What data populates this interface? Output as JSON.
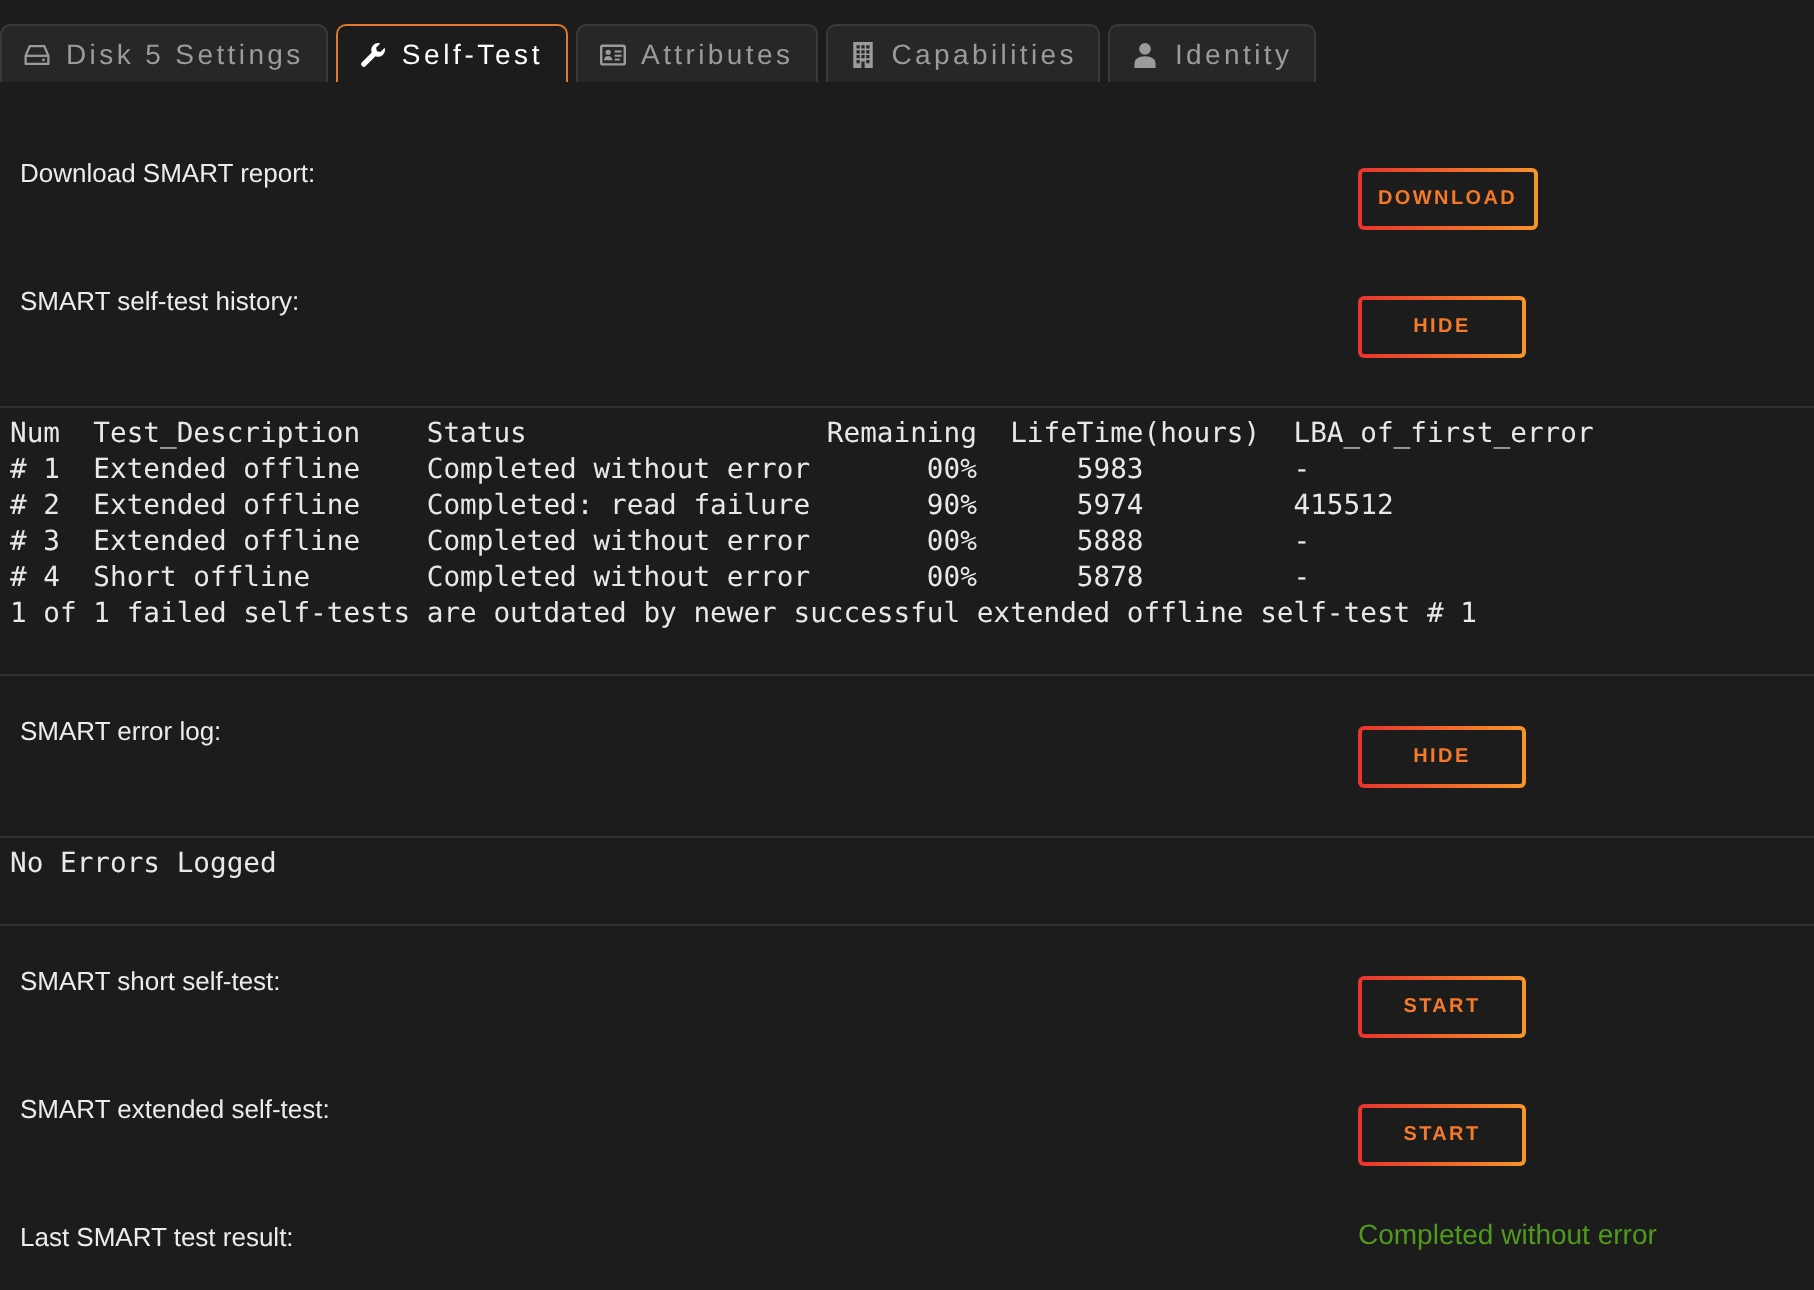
{
  "tabs": [
    {
      "label": "Disk 5 Settings",
      "selected": false
    },
    {
      "label": "Self-Test",
      "selected": true
    },
    {
      "label": "Attributes",
      "selected": false
    },
    {
      "label": "Capabilities",
      "selected": false
    },
    {
      "label": "Identity",
      "selected": false
    }
  ],
  "rows": [
    {
      "kind": "action",
      "label": "Download SMART report:",
      "button": "DOWNLOAD"
    },
    {
      "kind": "action",
      "label": "SMART self-test history:",
      "button": "HIDE"
    },
    {
      "kind": "log",
      "lines": [
        "Num  Test_Description    Status                  Remaining  LifeTime(hours)  LBA_of_first_error",
        "# 1  Extended offline    Completed without error       00%      5983         -",
        "# 2  Extended offline    Completed: read failure       90%      5974         415512",
        "# 3  Extended offline    Completed without error       00%      5888         -",
        "# 4  Short offline       Completed without error       00%      5878         -",
        "1 of 1 failed self-tests are outdated by newer successful extended offline self-test # 1"
      ]
    },
    {
      "kind": "action",
      "label": "SMART error log:",
      "button": "HIDE"
    },
    {
      "kind": "log",
      "lines": [
        "No Errors Logged"
      ]
    },
    {
      "kind": "action",
      "label": "SMART short self-test:",
      "button": "START"
    },
    {
      "kind": "action",
      "label": "SMART extended self-test:",
      "button": "START"
    },
    {
      "kind": "result",
      "label": "Last SMART test result:",
      "value": "Completed without error"
    }
  ]
}
